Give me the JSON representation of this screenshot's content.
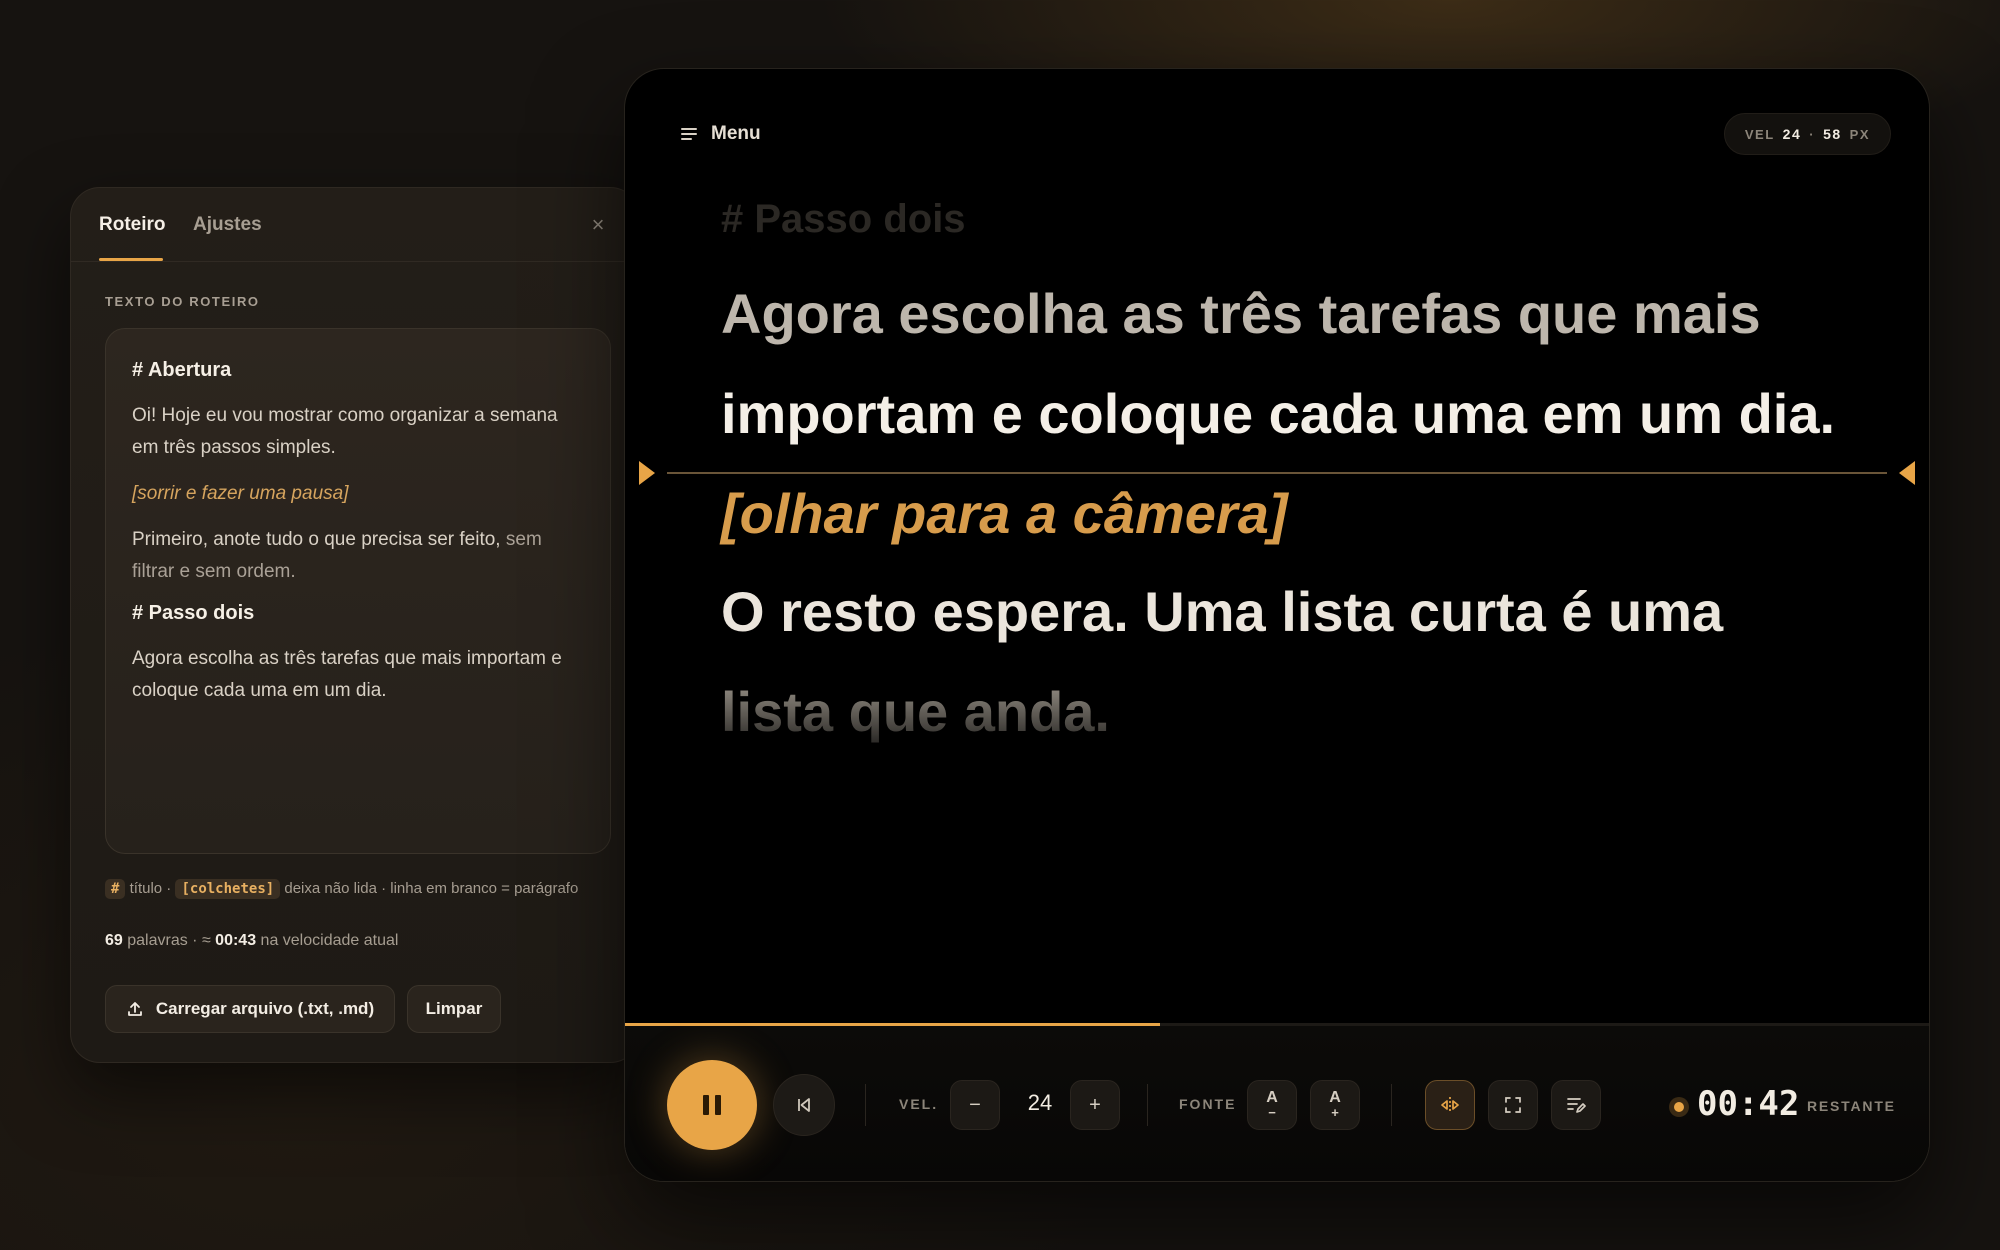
{
  "panel": {
    "tabs": [
      "Roteiro",
      "Ajustes"
    ],
    "close_icon": "×",
    "section_label": "TEXTO DO ROTEIRO",
    "editor": {
      "heading1": "# Abertura",
      "para1": "Oi! Hoje eu vou mostrar como organizar a semana em três passos simples.",
      "cue": "[sorrir e fazer uma pausa]",
      "para2_main": "Primeiro, anote tudo o que precisa ser feito,",
      "para2_dim": " sem filtrar e sem ordem.",
      "heading2": "# Passo dois",
      "para3": "Agora escolha as três tarefas que mais importam e coloque cada uma em um dia."
    },
    "hint": {
      "hash_code": "#",
      "hash_text": " título · ",
      "bracket_code": "[colchetes]",
      "bracket_text": " deixa não lida · linha em branco = parágrafo"
    },
    "stats": {
      "words": "69",
      "words_label": " palavras · ≈ ",
      "time": "00:43",
      "time_label": " na velocidade atual"
    },
    "buttons": {
      "upload": "Carregar arquivo (.txt, .md)",
      "clear": "Limpar"
    }
  },
  "prompter": {
    "menu_label": "Menu",
    "readout": {
      "vel_label": "VEL",
      "vel_value": "24",
      "sep": "·",
      "px_value": "58",
      "px_label": "PX"
    },
    "lines": {
      "heading": "# Passo dois",
      "line1": "Agora escolha as três tarefas que mais",
      "line2": "importam e coloque cada uma em um dia.",
      "cue": "[olhar para a câmera]",
      "line4": "O resto espera. Uma lista curta é uma",
      "line5": "lista que anda."
    },
    "progress": 0.41,
    "controls": {
      "speed_label": "VEL.",
      "speed_value": "24",
      "minus": "−",
      "plus": "+",
      "font_label": "FONTE",
      "font_minus_letter": "A",
      "font_minus_sign": "−",
      "font_plus_letter": "A",
      "font_plus_sign": "+",
      "timer": "00:42",
      "timer_label": "RESTANTE"
    }
  },
  "colors": {
    "accent": "#e8a547",
    "background": "#161310",
    "prompter_bg": "#000000",
    "cue_text": "#d79c4c"
  },
  "icons": [
    "menu-icon",
    "close-icon",
    "upload-icon",
    "pause-icon",
    "restart-icon",
    "mirror-icon",
    "fullscreen-icon",
    "edit-icon",
    "recording-dot-icon"
  ]
}
